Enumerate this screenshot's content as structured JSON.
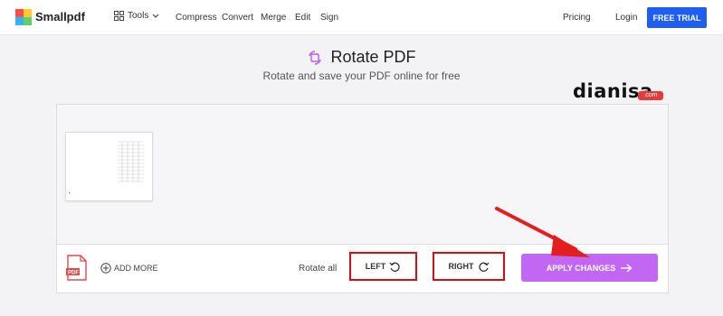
{
  "nav": {
    "brand": "Smallpdf",
    "tools_label": "Tools",
    "links": [
      "Compress",
      "Convert",
      "Merge",
      "Edit",
      "Sign"
    ],
    "pricing": "Pricing",
    "login": "Login",
    "cta": "FREE TRIAL"
  },
  "header": {
    "title": "Rotate PDF",
    "subtitle": "Rotate and save your PDF online for free"
  },
  "watermark": {
    "text": "dianisa",
    "suffix": ".com"
  },
  "toolbar": {
    "add_more": "ADD MORE",
    "rotate_all": "Rotate all",
    "left": "LEFT",
    "right": "RIGHT",
    "apply": "APPLY CHANGES"
  },
  "colors": {
    "accent": "#1f5ef2",
    "apply": "#c266f4",
    "highlight": "#d40e17"
  }
}
